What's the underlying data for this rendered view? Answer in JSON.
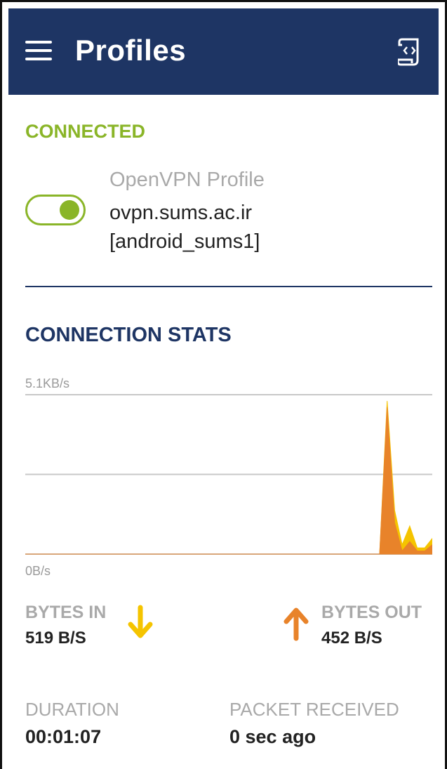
{
  "header": {
    "title": "Profiles",
    "menu_icon": "hamburger-menu-icon",
    "log_icon": "log-file-icon",
    "background": "#1e3564"
  },
  "connection": {
    "status": "CONNECTED",
    "status_color": "#8ab528",
    "toggle_on": true,
    "profile_type": "OpenVPN Profile",
    "profile_name": "ovpn.sums.ac.ir [android_sums1]"
  },
  "stats": {
    "title": "CONNECTION STATS",
    "bytes_in_label": "BYTES IN",
    "bytes_in_value": "519 B/S",
    "bytes_out_label": "BYTES OUT",
    "bytes_out_value": "452 B/S",
    "in_color": "#f5c400",
    "out_color": "#e8832a"
  },
  "chart_data": {
    "type": "area",
    "max_label": "5.1KB/s",
    "min_label": "0B/s",
    "ylim": [
      0,
      5.1
    ],
    "gridlines": 3,
    "x": [
      0,
      1,
      2,
      3,
      4,
      5,
      6,
      7,
      8,
      9,
      10,
      11,
      12,
      13,
      14,
      15,
      16,
      17,
      18,
      19,
      20
    ],
    "series": [
      {
        "values": [
          0,
          0,
          0,
          0,
          0,
          0,
          0,
          0,
          0,
          0,
          0,
          0,
          0,
          0,
          4.9,
          1.4,
          0.3,
          0.9,
          0.2,
          0.2,
          0.5
        ],
        "color": "#f5c400"
      },
      {
        "values": [
          0,
          0,
          0,
          0,
          0,
          0,
          0,
          0,
          0,
          0,
          0,
          0,
          0,
          0,
          4.7,
          1.0,
          0.1,
          0.4,
          0.1,
          0.1,
          0.3
        ],
        "color": "#e8832a"
      }
    ]
  },
  "info": {
    "duration_label": "DURATION",
    "duration_value": "00:01:07",
    "packet_label": "PACKET RECEIVED",
    "packet_value": "0 sec ago"
  }
}
